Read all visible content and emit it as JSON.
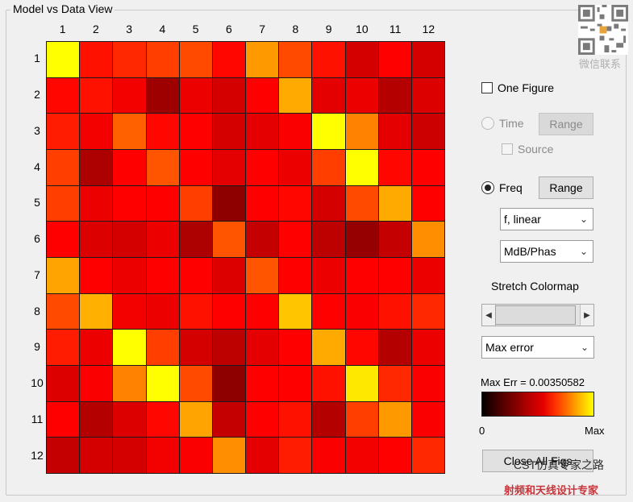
{
  "panel": {
    "title": "Model vs Data View"
  },
  "matrix": {
    "column_labels": [
      "1",
      "2",
      "3",
      "4",
      "5",
      "6",
      "7",
      "8",
      "9",
      "10",
      "11",
      "12"
    ],
    "row_labels": [
      "1",
      "2",
      "3",
      "4",
      "5",
      "6",
      "7",
      "8",
      "9",
      "10",
      "11",
      "12"
    ],
    "colormap": "hot",
    "levels": [
      [
        1.0,
        0.58,
        0.62,
        0.66,
        0.68,
        0.56,
        0.82,
        0.68,
        0.58,
        0.34,
        0.54,
        0.34
      ],
      [
        0.56,
        0.58,
        0.42,
        0.2,
        0.4,
        0.34,
        0.46,
        0.85,
        0.38,
        0.4,
        0.26,
        0.36
      ],
      [
        0.6,
        0.42,
        0.72,
        0.56,
        0.48,
        0.34,
        0.38,
        0.44,
        1.0,
        0.78,
        0.38,
        0.32
      ],
      [
        0.66,
        0.24,
        0.54,
        0.7,
        0.46,
        0.38,
        0.46,
        0.4,
        0.66,
        1.0,
        0.56,
        0.5
      ],
      [
        0.66,
        0.4,
        0.46,
        0.48,
        0.66,
        0.16,
        0.48,
        0.56,
        0.34,
        0.68,
        0.85,
        0.46
      ],
      [
        0.54,
        0.36,
        0.34,
        0.4,
        0.24,
        0.7,
        0.3,
        0.5,
        0.28,
        0.18,
        0.3,
        0.8
      ],
      [
        0.84,
        0.48,
        0.4,
        0.48,
        0.46,
        0.36,
        0.7,
        0.48,
        0.4,
        0.52,
        0.46,
        0.4
      ],
      [
        0.68,
        0.86,
        0.42,
        0.4,
        0.58,
        0.5,
        0.54,
        0.9,
        0.5,
        0.44,
        0.58,
        0.62
      ],
      [
        0.6,
        0.4,
        1.0,
        0.66,
        0.34,
        0.28,
        0.38,
        0.5,
        0.85,
        0.56,
        0.26,
        0.4
      ],
      [
        0.36,
        0.44,
        0.78,
        1.0,
        0.68,
        0.16,
        0.52,
        0.46,
        0.58,
        0.96,
        0.62,
        0.44
      ],
      [
        0.54,
        0.26,
        0.36,
        0.56,
        0.84,
        0.3,
        0.5,
        0.58,
        0.26,
        0.66,
        0.82,
        0.44
      ],
      [
        0.3,
        0.34,
        0.34,
        0.42,
        0.44,
        0.8,
        0.38,
        0.6,
        0.44,
        0.42,
        0.48,
        0.62
      ]
    ]
  },
  "controls": {
    "one_figure_label": "One Figure",
    "time_label": "Time",
    "time_range_button": "Range",
    "source_label": "Source",
    "freq_label": "Freq",
    "freq_range_button": "Range",
    "freq_select_value": "f, linear",
    "format_select_value": "MdB/Phas",
    "stretch_label": "Stretch Colormap",
    "error_select_value": "Max error",
    "max_err_label": "Max Err = 0.00350582",
    "colorbar_min_label": "0",
    "colorbar_max_label": "Max",
    "close_button": "Close All Figs"
  },
  "watermark": {
    "qr_caption": "微信联系",
    "line1": "CST仿真专家之路",
    "line2": "射频和天线设计专家"
  },
  "colors": {
    "background": "#f0f0f0",
    "grid_line": "#1a1a1a"
  }
}
